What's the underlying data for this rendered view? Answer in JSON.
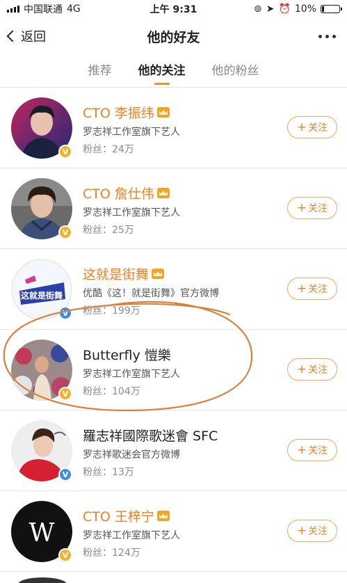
{
  "status_bar": {
    "carrier": "中国联通",
    "network": "4G",
    "time": "上午 9:31",
    "battery": "10%"
  },
  "nav": {
    "back_label": "返回",
    "title": "他的好友"
  },
  "tabs": [
    {
      "label": "推荐",
      "active": false
    },
    {
      "label": "他的关注",
      "active": true
    },
    {
      "label": "他的粉丝",
      "active": false
    }
  ],
  "follow_label": "关注",
  "users": [
    {
      "name": "CTO 李振纬",
      "vip": true,
      "desc": "罗志祥工作室旗下艺人",
      "fans": "粉丝：24万",
      "verify": "gold"
    },
    {
      "name": "CTO 詹仕伟",
      "vip": true,
      "desc": "罗志祥工作室旗下艺人",
      "fans": "粉丝：25万",
      "verify": "gold"
    },
    {
      "name": "这就是街舞",
      "vip": true,
      "desc": "优酷《这！就是街舞》官方微博",
      "fans": "粉丝：199万",
      "verify": "blue"
    },
    {
      "name": "Butterfly 愷樂",
      "vip": false,
      "desc": "罗志祥工作室旗下艺人",
      "fans": "粉丝：104万",
      "verify": "gold"
    },
    {
      "name": "羅志祥國際歌迷會 SFC",
      "vip": false,
      "desc": "罗志祥歌迷会官方微博",
      "fans": "粉丝：13万",
      "verify": "blue"
    },
    {
      "name": "CTO 王梓宁",
      "vip": true,
      "desc": "罗志祥工作室旗下艺人",
      "fans": "粉丝：124万",
      "verify": "gold"
    }
  ],
  "avatar_art": {
    "logo_text_3": "这就是街舞",
    "logo_text_6": "W"
  },
  "annotation_color": "#d9803a",
  "accent_color": "#f28021"
}
